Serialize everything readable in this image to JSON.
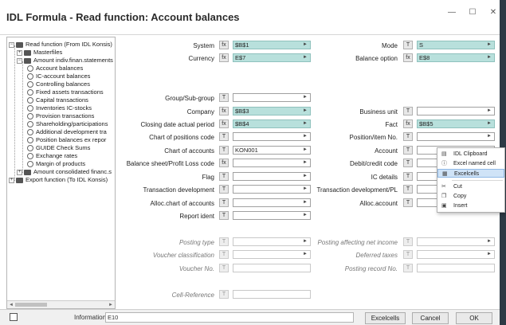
{
  "window": {
    "title": "IDL Formula - Read function: Account balances",
    "minimize": "—",
    "maximize": "☐",
    "close": "✕"
  },
  "tree": {
    "items": [
      {
        "label": "Read function (From IDL Konsis)",
        "expander": "−",
        "icon": "folder-icon"
      },
      {
        "label": "Masterfiles",
        "expander": "+",
        "icon": "folder-icon"
      },
      {
        "label": "Amount indiv.finan.statements",
        "expander": "−",
        "icon": "folder-icon"
      },
      {
        "label": "Account balances",
        "icon": "gear-icon"
      },
      {
        "label": "IC-account balances",
        "icon": "gear-icon"
      },
      {
        "label": "Controlling balances",
        "icon": "gear-icon"
      },
      {
        "label": "Fixed assets transactions",
        "icon": "gear-icon"
      },
      {
        "label": "Capital transactions",
        "icon": "gear-icon"
      },
      {
        "label": "Inventories IC-stocks",
        "icon": "gear-icon"
      },
      {
        "label": "Provision transactions",
        "icon": "gear-icon"
      },
      {
        "label": "Shareholding/participations",
        "icon": "gear-icon"
      },
      {
        "label": "Additional development tra",
        "icon": "gear-icon"
      },
      {
        "label": "Position balances ex repor",
        "icon": "gear-icon"
      },
      {
        "label": "GUIDE Check Sums",
        "icon": "gear-icon"
      },
      {
        "label": "Exchange rates",
        "icon": "gear-icon"
      },
      {
        "label": "Margin of products",
        "icon": "gear-icon"
      },
      {
        "label": "Amount consolidated financ.s",
        "expander": "+",
        "icon": "folder-icon"
      },
      {
        "label": "Export function (To IDL Konsis)",
        "expander": "+",
        "icon": "folder-icon"
      }
    ]
  },
  "form": {
    "system": {
      "label": "System",
      "mode": "fx",
      "value": "$B$1"
    },
    "currency": {
      "label": "Currency",
      "mode": "fx",
      "value": "E$7"
    },
    "mode_field": {
      "label": "Mode",
      "mode": "T",
      "value": "S"
    },
    "balance_option": {
      "label": "Balance option",
      "mode": "fx",
      "value": "E$8"
    },
    "group_subgroup": {
      "label": "Group/Sub-group",
      "mode": "T",
      "value": ""
    },
    "company": {
      "label": "Company",
      "mode": "fx",
      "value": "$B$3"
    },
    "closing_date": {
      "label": "Closing date actual period",
      "mode": "fx",
      "value": "$B$4"
    },
    "chart_positions_code": {
      "label": "Chart of positions code",
      "mode": "T",
      "value": ""
    },
    "chart_accounts": {
      "label": "Chart of accounts",
      "mode": "T",
      "value": "KON001"
    },
    "balance_sheet_loss": {
      "label": "Balance sheet/Profit  Loss code",
      "mode": "fx",
      "value": ""
    },
    "flag": {
      "label": "Flag",
      "mode": "T",
      "value": ""
    },
    "transaction_development": {
      "label": "Transaction development",
      "mode": "T",
      "value": ""
    },
    "alloc_chart_accounts": {
      "label": "Alloc.chart of accounts",
      "mode": "T",
      "value": ""
    },
    "report_ident": {
      "label": "Report ident",
      "mode": "T",
      "value": ""
    },
    "business_unit": {
      "label": "Business unit",
      "mode": "T",
      "value": ""
    },
    "fact": {
      "label": "Fact",
      "mode": "fx",
      "value": "$B$5"
    },
    "position_item_no": {
      "label": "Position/item No.",
      "mode": "T",
      "value": ""
    },
    "account": {
      "label": "Account",
      "mode": "T",
      "value": ""
    },
    "debit_credit_code": {
      "label": "Debit/credit code",
      "mode": "T",
      "value": ""
    },
    "ic_details": {
      "label": "IC details",
      "mode": "T",
      "value": ""
    },
    "transaction_development_pl": {
      "label": "Transaction development/PL",
      "mode": "T",
      "value": ""
    },
    "alloc_account": {
      "label": "Alloc.account",
      "mode": "T",
      "value": ""
    },
    "posting_type": {
      "label": "Posting type",
      "mode": "T",
      "value": ""
    },
    "voucher_classification": {
      "label": "Voucher classification",
      "mode": "T",
      "value": ""
    },
    "voucher_no": {
      "label": "Voucher No.",
      "mode": "T",
      "value": ""
    },
    "cell_reference": {
      "label": "Cell-Reference",
      "mode": "T",
      "value": ""
    },
    "posting_affecting_net_income": {
      "label": "Posting affecting net income",
      "mode": "T",
      "value": ""
    },
    "deferred_taxes": {
      "label": "Deferred taxes",
      "mode": "T",
      "value": ""
    },
    "posting_record_no": {
      "label": "Posting record No.",
      "mode": "T",
      "value": ""
    }
  },
  "dropdown_glyph": "►",
  "status": {
    "info_label": "Information",
    "info_value": "E10",
    "excelcells_button": "Excelcells",
    "cancel_button": "Cancel",
    "ok_button": "OK"
  },
  "context_menu": {
    "items": [
      {
        "label": "IDL Clipboard",
        "icon": "clipboard-icon",
        "glyph": "▤"
      },
      {
        "label": "Excel named cell",
        "icon": "info-icon",
        "glyph": "ⓘ"
      },
      {
        "label": "Excelcells",
        "icon": "grid-icon",
        "glyph": "▦"
      },
      {
        "label": "Cut",
        "icon": "scissors-icon",
        "glyph": "✂"
      },
      {
        "label": "Copy",
        "icon": "copy-icon",
        "glyph": "❐"
      },
      {
        "label": "Insert",
        "icon": "paste-icon",
        "glyph": "▣"
      }
    ]
  }
}
